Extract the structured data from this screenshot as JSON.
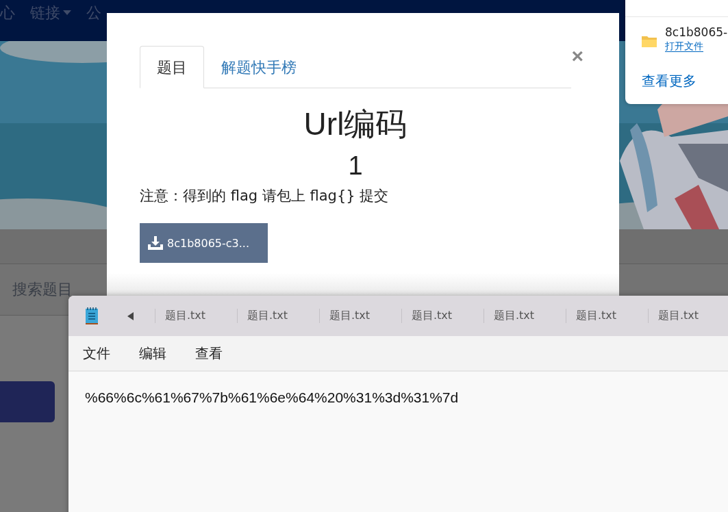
{
  "nav": {
    "items": [
      {
        "label": "心",
        "dropdown": false
      },
      {
        "label": "链接",
        "dropdown": true
      },
      {
        "label": "公",
        "dropdown": false
      }
    ]
  },
  "search_label": "搜索题目",
  "modal": {
    "tabs": [
      {
        "label": "题目",
        "selected": true
      },
      {
        "label": "解题快手榜",
        "selected": false
      }
    ],
    "close": "×",
    "title": "Url编码",
    "score": "1",
    "note": "注意：得到的 flag 请包上 flag{} 提交",
    "download_button": "8c1b8065-c3..."
  },
  "download_panel": {
    "file_name": "8c1b8065-",
    "open_link": "打开文件",
    "more_link": "查看更多"
  },
  "notepad": {
    "tabs": [
      {
        "label": "题目.txt"
      },
      {
        "label": "题目.txt"
      },
      {
        "label": "题目.txt"
      },
      {
        "label": "题目.txt"
      },
      {
        "label": "题目.txt"
      },
      {
        "label": "题目.txt"
      },
      {
        "label": "题目.txt"
      }
    ],
    "menu": [
      "文件",
      "编辑",
      "查看"
    ],
    "content": "%66%6c%61%67%7b%61%6e%64%20%31%3d%31%7d"
  }
}
